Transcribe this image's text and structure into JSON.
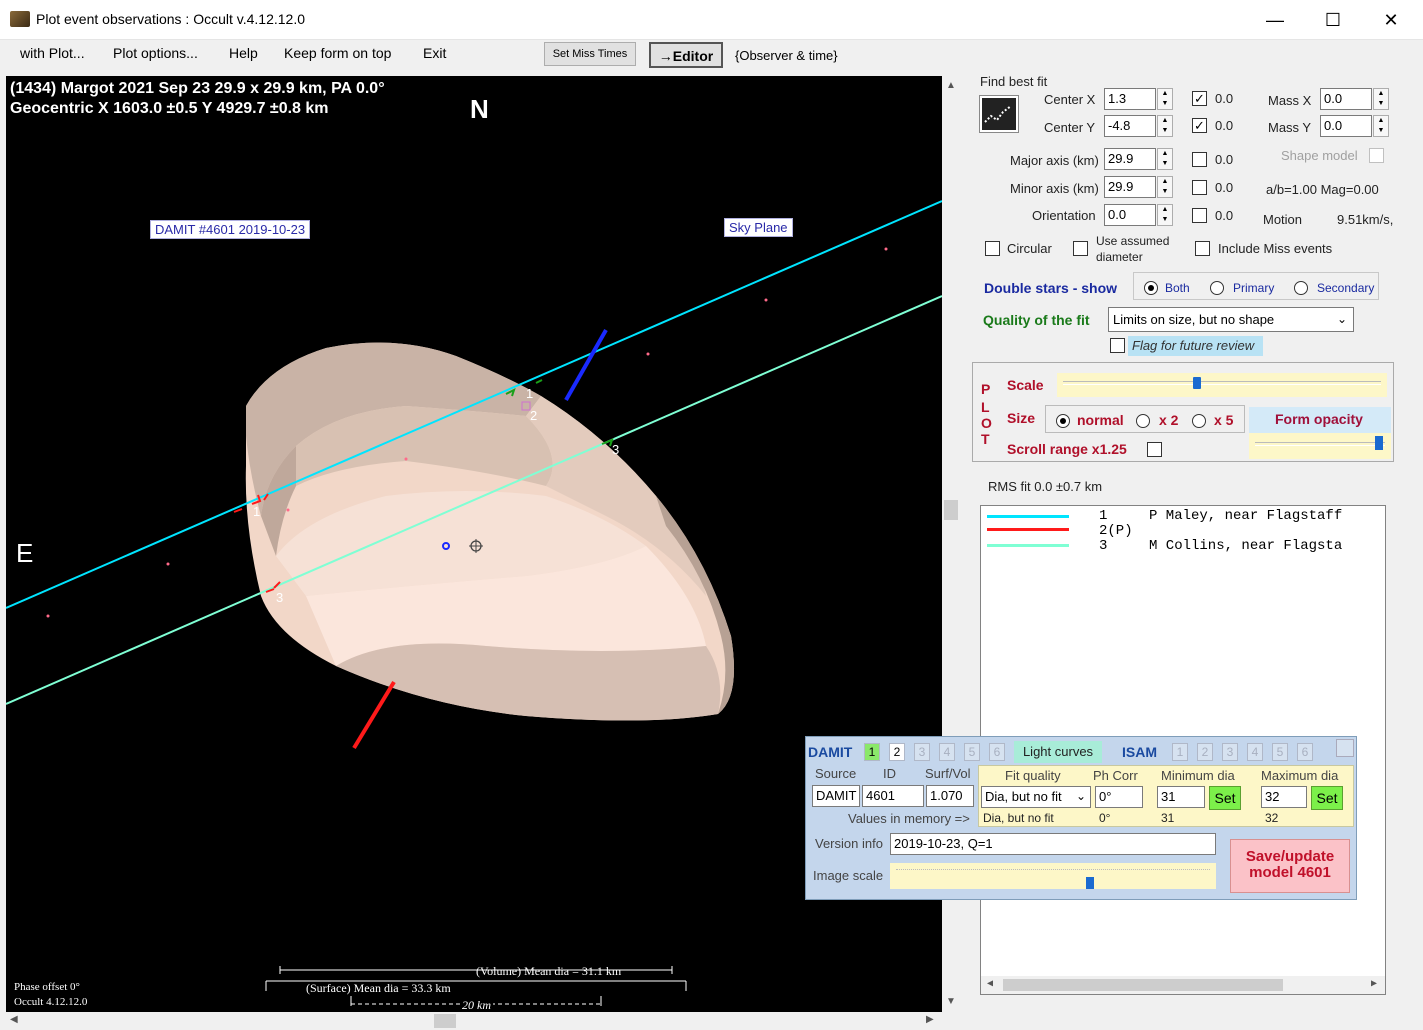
{
  "window": {
    "title": "Plot event observations : Occult v.4.12.12.0",
    "minimize": "—",
    "maximize": "☐",
    "close": "✕"
  },
  "menu": {
    "items": [
      "with Plot...",
      "Plot options...",
      "Help",
      "Keep form on top",
      "Exit"
    ],
    "set_miss_times": "Set Miss Times",
    "editor": "→Editor",
    "observer_time": "{Observer & time}"
  },
  "plot": {
    "header_line1": "(1434) Margot  2021 Sep 23  29.9 x 29.9 km, PA 0.0°",
    "header_line2": "Geocentric  X  1603.0 ±0.5  Y 4929.7 ±0.8 km",
    "north": "N",
    "east": "E",
    "damit_label": "DAMIT #4601 2019-10-23",
    "sky_plane_label": "Sky Plane",
    "chord_labels": [
      "1",
      "2",
      "3",
      "1",
      "3"
    ],
    "volume_dia": "(Volume) Mean dia = 31.1 km",
    "surface_dia": "(Surface) Mean dia = 33.3 km",
    "scale_bar": "20 km",
    "phase_offset": "Phase offset 0°",
    "version": "Occult 4.12.12.0"
  },
  "fit": {
    "find_best_fit": "Find best fit",
    "center_x_label": "Center X",
    "center_x": "1.3",
    "center_x_check": true,
    "center_x_unc": "0.0",
    "center_y_label": "Center Y",
    "center_y": "-4.8",
    "center_y_check": true,
    "center_y_unc": "0.0",
    "mass_x_label": "Mass X",
    "mass_x": "0.0",
    "mass_y_label": "Mass Y",
    "mass_y": "0.0",
    "major_label": "Major axis (km)",
    "major": "29.9",
    "major_unc": "0.0",
    "minor_label": "Minor axis (km)",
    "minor": "29.9",
    "minor_unc": "0.0",
    "orient_label": "Orientation",
    "orient": "0.0",
    "orient_unc": "0.0",
    "shape_model": "Shape model",
    "ab_mag": "a/b=1.00  Mag=0.00",
    "motion_label": "Motion",
    "motion_value": "9.51km/s,",
    "circular": "Circular",
    "use_assumed_1": "Use assumed",
    "use_assumed_2": "diameter",
    "include_miss": "Include Miss events"
  },
  "double_stars": {
    "label": "Double stars - show",
    "options": [
      "Both",
      "Primary",
      "Secondary"
    ],
    "selected": "Both"
  },
  "quality": {
    "label": "Quality of the fit",
    "value": "Limits on size, but no shape",
    "flag": "Flag for future review"
  },
  "plotpanel": {
    "vertical": [
      "P",
      "L",
      "O",
      "T"
    ],
    "scale": "Scale",
    "size": "Size",
    "size_options": [
      "normal",
      "x 2",
      "x 5"
    ],
    "size_selected": "normal",
    "form_opacity": "Form opacity",
    "scroll_range": "Scroll range x1.25",
    "scale_level": 0.42,
    "opacity_level": 0.97
  },
  "rms": "RMS fit  0.0 ±0.7 km",
  "legend": {
    "rows": [
      {
        "num": "1",
        "name": "P Maley, near Flagstaff",
        "color": "#00e5ff"
      },
      {
        "num": "2(P)",
        "name": "",
        "color": "#ff1a1a"
      },
      {
        "num": "3",
        "name": "M Collins, near Flagsta",
        "color": "#7fffd4"
      }
    ]
  },
  "damit": {
    "title": "DAMIT",
    "tabs": [
      "1",
      "2",
      "3",
      "4",
      "5",
      "6"
    ],
    "light_curves": "Light curves",
    "isam": "ISAM",
    "isam_tabs": [
      "1",
      "2",
      "3",
      "4",
      "5",
      "6"
    ],
    "source_label": "Source",
    "id_label": "ID",
    "surfvol_label": "Surf/Vol",
    "source": "DAMIT",
    "id": "4601",
    "surfvol": "1.070",
    "fit_quality_label": "Fit quality",
    "ph_corr_label": "Ph Corr",
    "min_dia_label": "Minimum dia",
    "max_dia_label": "Maximum dia",
    "fit_quality": "Dia, but no fit",
    "ph_corr": "0°",
    "min_dia": "31",
    "max_dia": "32",
    "set": "Set",
    "values_in_memory": "Values in memory =>",
    "mem_fit_quality": "Dia, but no fit",
    "mem_ph_corr": "0°",
    "mem_min": "31",
    "mem_max": "32",
    "version_label": "Version info",
    "version": "2019-10-23, Q=1",
    "image_scale": "Image scale",
    "image_scale_level": 0.62,
    "save": "Save/update model 4601"
  }
}
